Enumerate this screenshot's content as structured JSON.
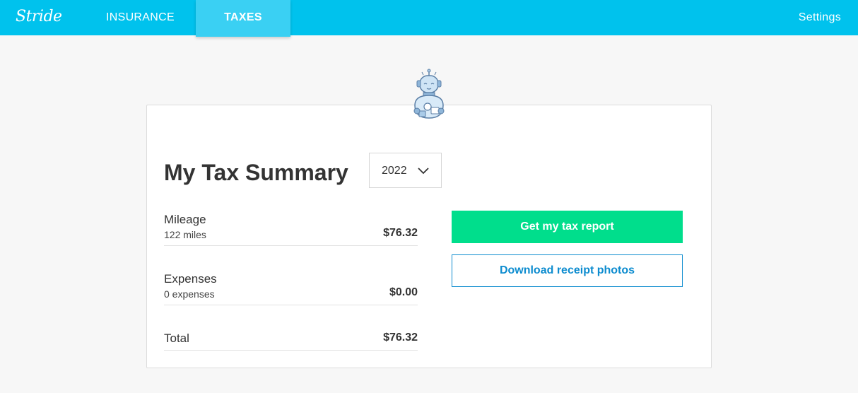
{
  "nav": {
    "logo": "Stride",
    "items": [
      {
        "label": "INSURANCE",
        "active": false
      },
      {
        "label": "TAXES",
        "active": true
      }
    ],
    "settings_label": "Settings",
    "bar_color": "#00c2ed"
  },
  "summary": {
    "mascot_icon": "robot-icon",
    "title": "My Tax Summary",
    "year_selected": "2022",
    "rows": [
      {
        "label": "Mileage",
        "sub": "122 miles",
        "amount": "$76.32"
      },
      {
        "label": "Expenses",
        "sub": "0 expenses",
        "amount": "$0.00"
      },
      {
        "label": "Total",
        "amount": "$76.32"
      }
    ]
  },
  "actions": {
    "primary_label": "Get my tax report",
    "primary_color": "#00de8c",
    "secondary_label": "Download receipt photos",
    "secondary_color": "#0d8ccf"
  }
}
